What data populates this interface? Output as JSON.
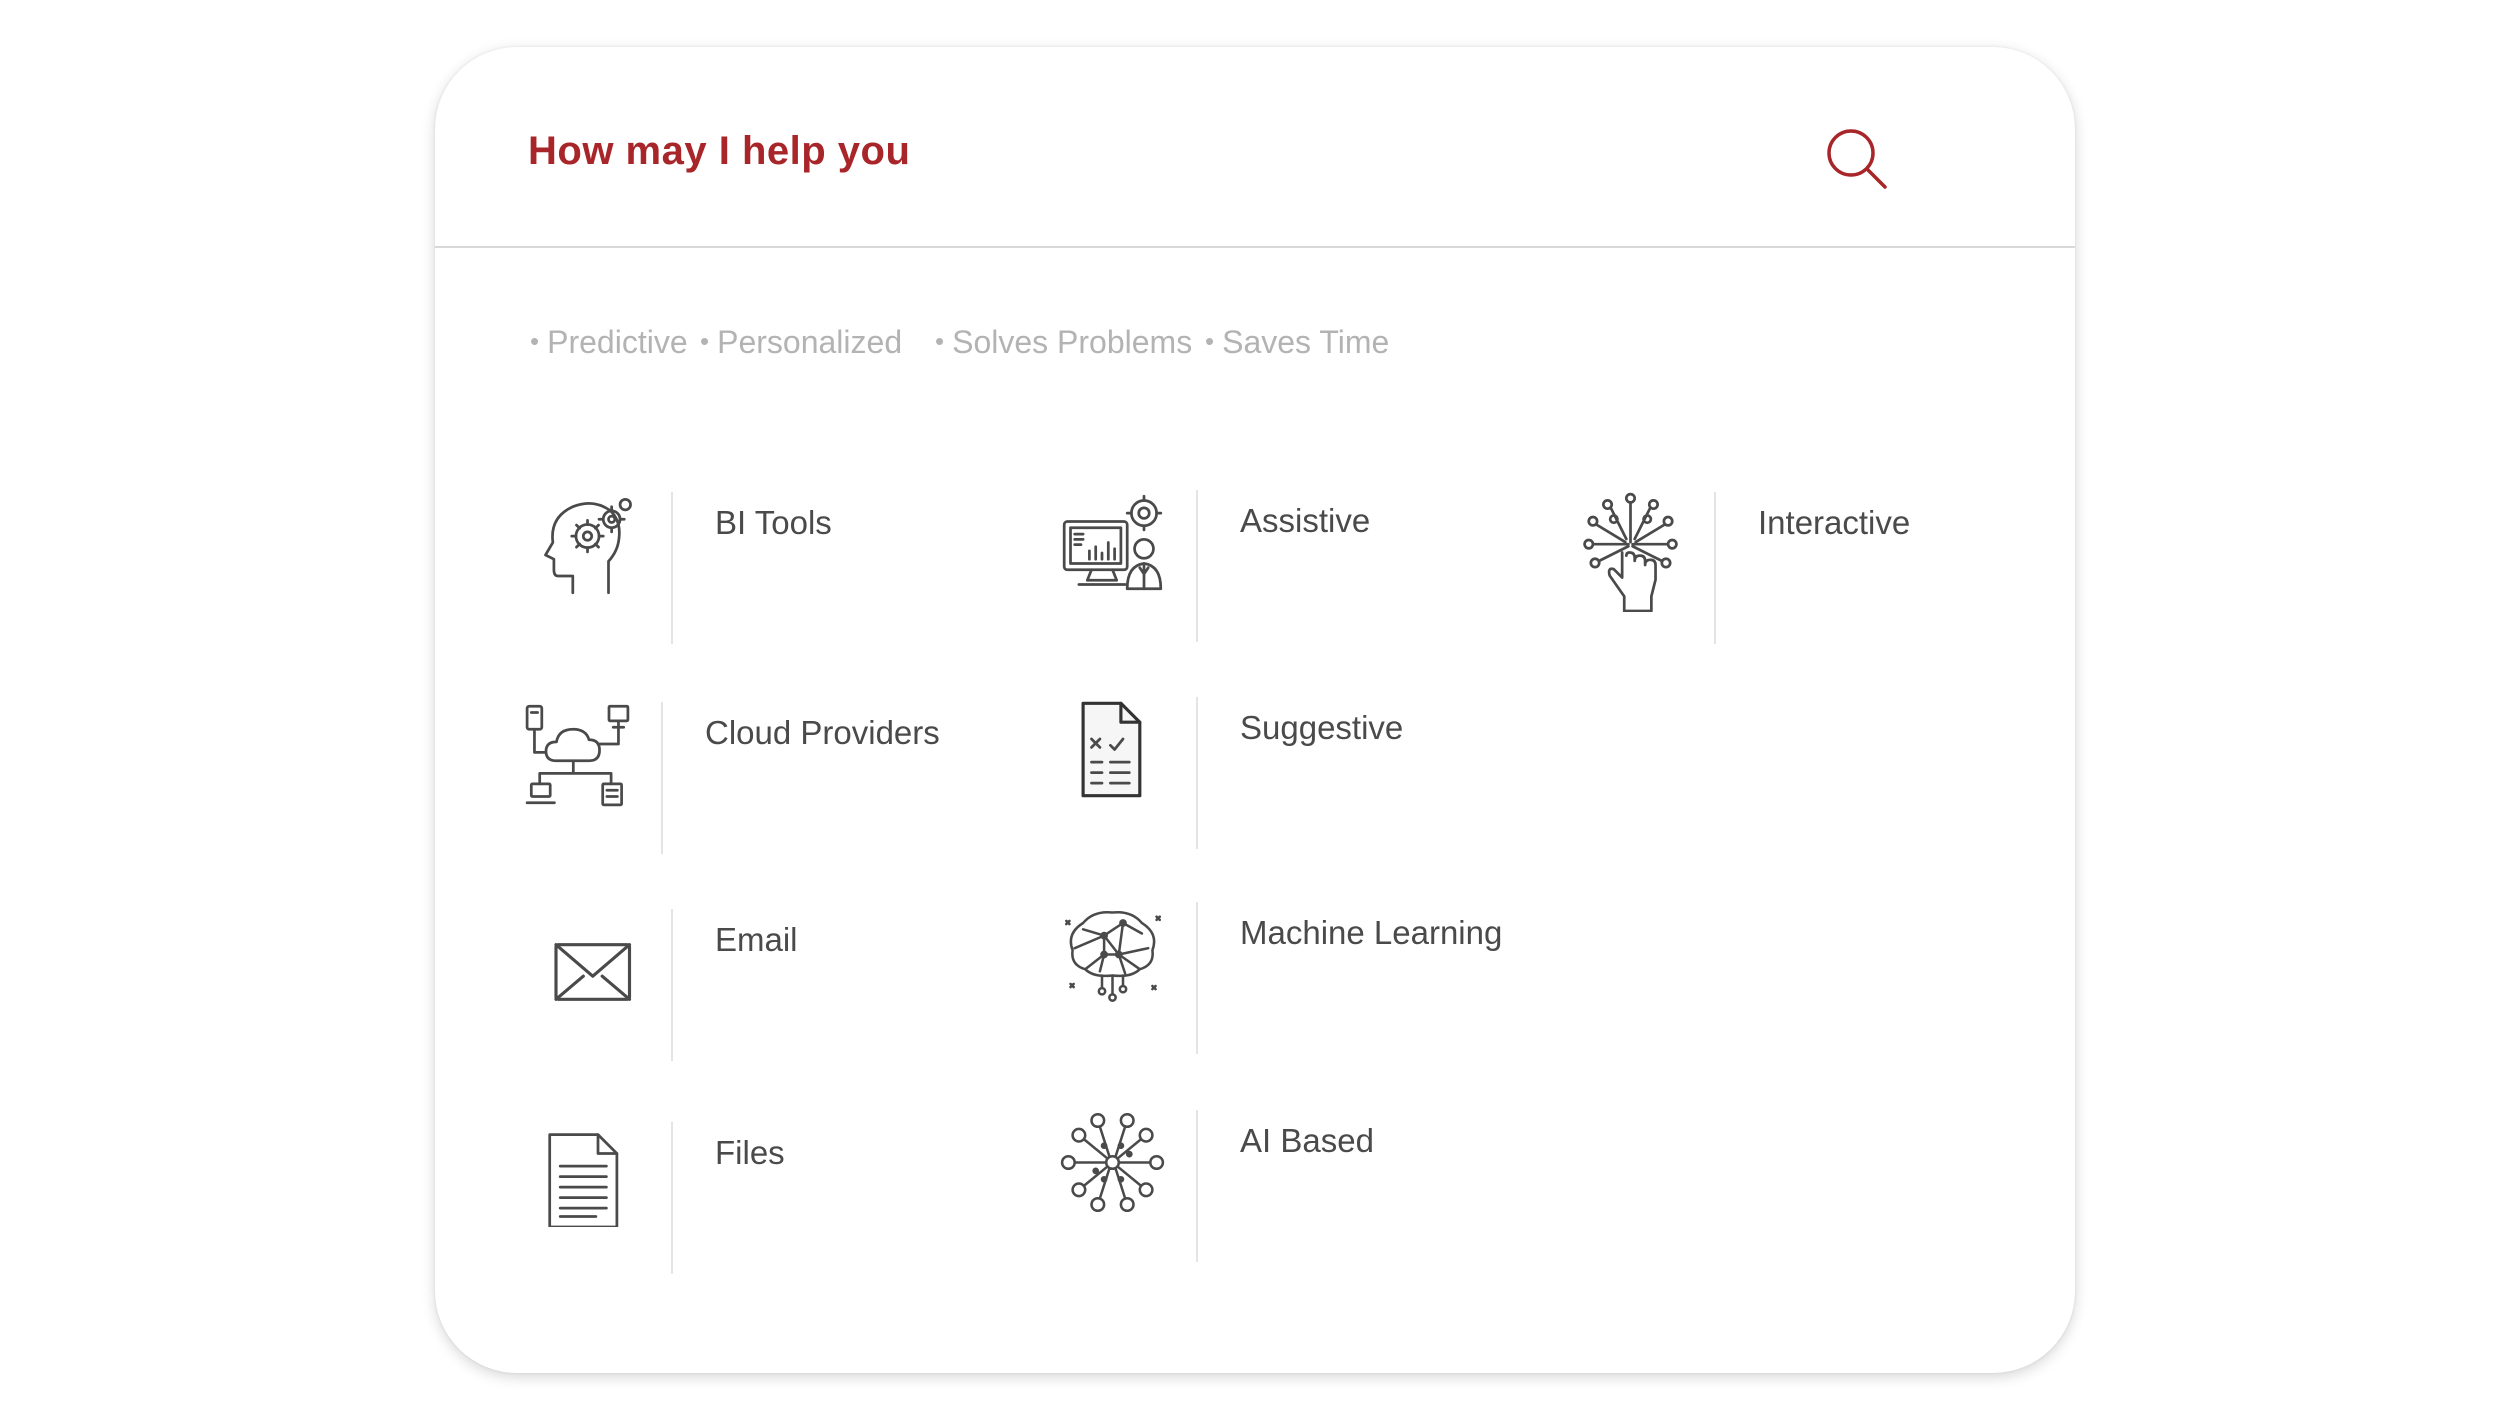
{
  "search": {
    "prompt": "How may I help you",
    "icon": "search-icon"
  },
  "tags": [
    "Predictive",
    "Personalized",
    "Solves Problems",
    "Saves Time"
  ],
  "features": {
    "bi_tools": {
      "label": "BI Tools",
      "icon": "head-gears-icon"
    },
    "assistive": {
      "label": "Assistive",
      "icon": "monitor-analyst-icon"
    },
    "interactive": {
      "label": "Interactive",
      "icon": "touch-network-icon"
    },
    "cloud_providers": {
      "label": "Cloud Providers",
      "icon": "cloud-network-icon"
    },
    "suggestive": {
      "label": "Suggestive",
      "icon": "checklist-document-icon"
    },
    "email": {
      "label": "Email",
      "icon": "envelope-icon"
    },
    "machine_learning": {
      "label": "Machine Learning",
      "icon": "neural-brain-icon"
    },
    "files": {
      "label": "Files",
      "icon": "file-icon"
    },
    "ai_based": {
      "label": "AI Based",
      "icon": "ai-network-icon"
    }
  },
  "colors": {
    "accent": "#a8262a",
    "text": "#4a4a4a",
    "muted": "#b3b3b3"
  }
}
